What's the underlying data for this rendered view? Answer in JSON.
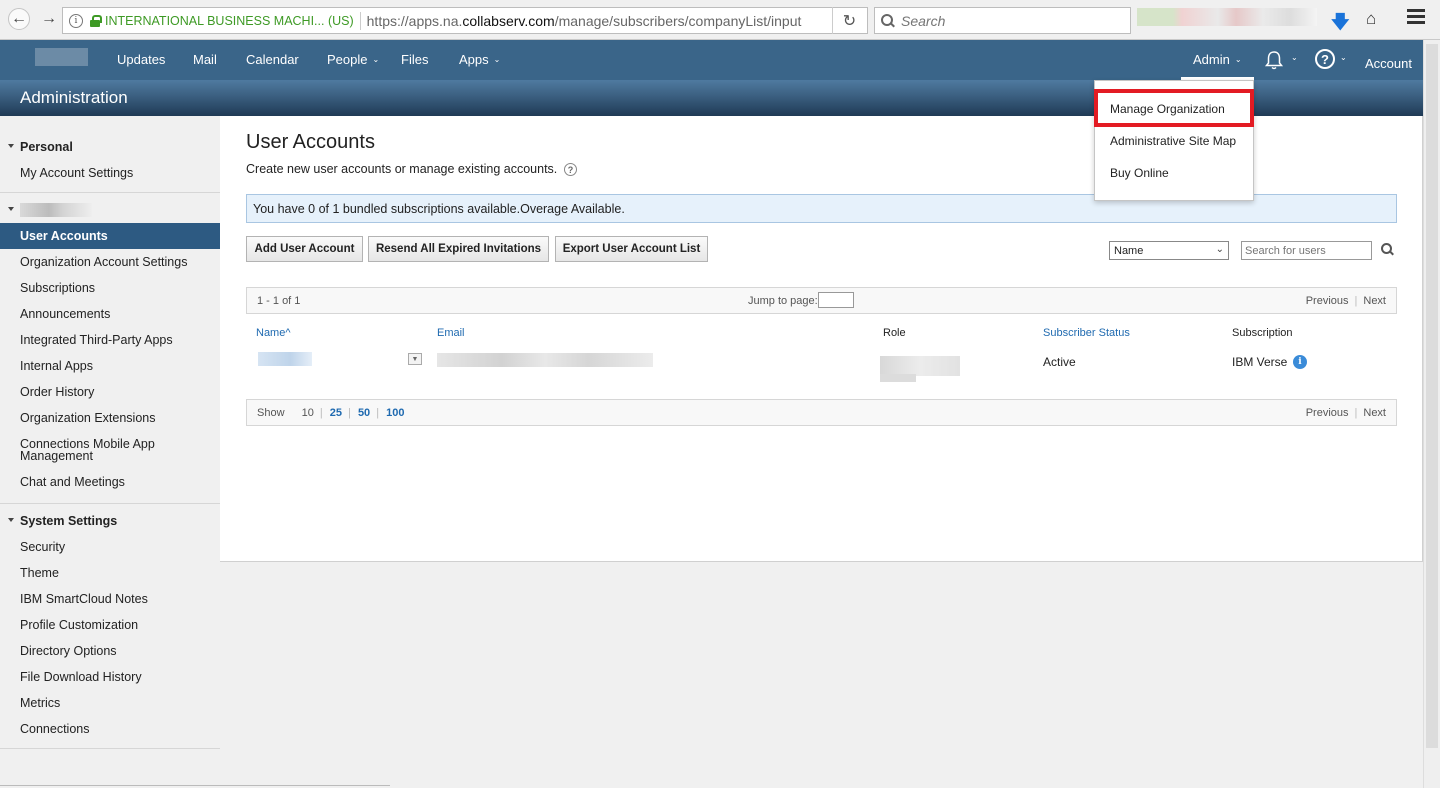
{
  "browser": {
    "site_identity": "INTERNATIONAL BUSINESS MACHI... (US)",
    "url_prefix": "https://apps.na.",
    "url_domain": "collabserv.com",
    "url_path": "/manage/subscribers/companyList/input",
    "search_placeholder": "Search"
  },
  "nav": {
    "items": [
      "Updates",
      "Mail",
      "Calendar",
      "People",
      "Files",
      "Apps"
    ],
    "admin": "Admin",
    "account": "Account"
  },
  "admin_menu": {
    "items": [
      "Manage Organization",
      "Administrative Site Map",
      "Buy Online"
    ],
    "highlight_color": "#e31b23"
  },
  "header": {
    "title": "Administration"
  },
  "sidebar": {
    "personal_heading": "Personal",
    "personal_items": [
      "My Account Settings"
    ],
    "org_items": [
      "User Accounts",
      "Organization Account Settings",
      "Subscriptions",
      "Announcements",
      "Integrated Third-Party Apps",
      "Internal Apps",
      "Order History",
      "Organization Extensions",
      "Connections Mobile App Management",
      "Chat and Meetings"
    ],
    "system_heading": "System Settings",
    "system_items": [
      "Security",
      "Theme",
      "IBM SmartCloud Notes",
      "Profile Customization",
      "Directory Options",
      "File Download History",
      "Metrics",
      "Connections"
    ],
    "active_item": "User Accounts"
  },
  "main": {
    "title": "User Accounts",
    "description": "Create new user accounts or manage existing accounts.",
    "notice": "You have 0 of 1 bundled subscriptions available.Overage Available.",
    "buttons": {
      "add": "Add User Account",
      "resend": "Resend All Expired Invitations",
      "export": "Export User Account List"
    },
    "search_field_select": "Name",
    "search_placeholder": "Search for users",
    "pager": {
      "range": "1 - 1 of 1",
      "jump_label": "Jump to page:",
      "previous": "Previous",
      "next": "Next"
    },
    "columns": {
      "name": "Name",
      "sort_indicator": "^",
      "email": "Email",
      "role": "Role",
      "status": "Subscriber Status",
      "subscription": "Subscription"
    },
    "rows": [
      {
        "status": "Active",
        "subscription": "IBM Verse"
      }
    ],
    "show": {
      "label": "Show",
      "sizes": [
        "10",
        "25",
        "50",
        "100"
      ]
    }
  }
}
